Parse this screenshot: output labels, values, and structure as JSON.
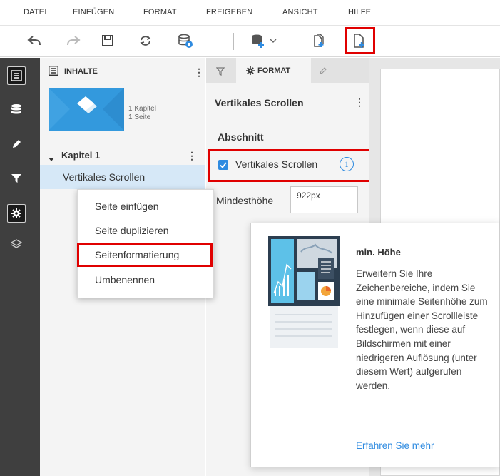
{
  "menu": {
    "items": [
      "DATEI",
      "EINFÜGEN",
      "FORMAT",
      "FREIGEBEN",
      "ANSICHT",
      "HILFE"
    ]
  },
  "toolbar": {
    "icons": [
      "undo-icon",
      "redo-icon",
      "save-icon",
      "refresh-icon",
      "database-settings-icon",
      "add-data-icon",
      "copy-page-icon",
      "new-page-icon"
    ]
  },
  "rail": {
    "icons": [
      "contents-icon",
      "data-icon",
      "edit-icon",
      "filter-icon",
      "settings-icon",
      "layers-icon"
    ],
    "selected": "contents-icon"
  },
  "contents": {
    "title": "INHALTE",
    "thumb_meta_1": "1 Kapitel",
    "thumb_meta_2": "1 Seite",
    "chapter": "Kapitel 1",
    "page": "Vertikales Scrollen"
  },
  "context_menu": {
    "items": [
      "Seite einfügen",
      "Seite duplizieren",
      "Seitenformatierung",
      "Umbenennen"
    ],
    "highlighted": "Seitenformatierung"
  },
  "format_panel": {
    "tab_label": "FORMAT",
    "title": "Vertikales Scrollen",
    "section": "Abschnitt",
    "checkbox_label": "Vertikales Scrollen",
    "checkbox_checked": true,
    "min_height_label": "Mindesthöhe",
    "min_height_value": "922px"
  },
  "tooltip": {
    "title": "min. Höhe",
    "body": "Erweitern Sie Ihre Zeichenbereiche, indem Sie eine minimale Seitenhöhe zum Hinzufügen einer Scrollleiste festlegen, wenn diese auf Bildschirmen mit einer niedrigeren Auflösung (unter diesem Wert) aufgerufen werden.",
    "link": "Erfahren Sie mehr"
  },
  "colors": {
    "accent_blue": "#2f8be0",
    "highlight_red": "#e00000",
    "rail_bg": "#3f3f3f",
    "selected_row": "#d6e8f7"
  }
}
